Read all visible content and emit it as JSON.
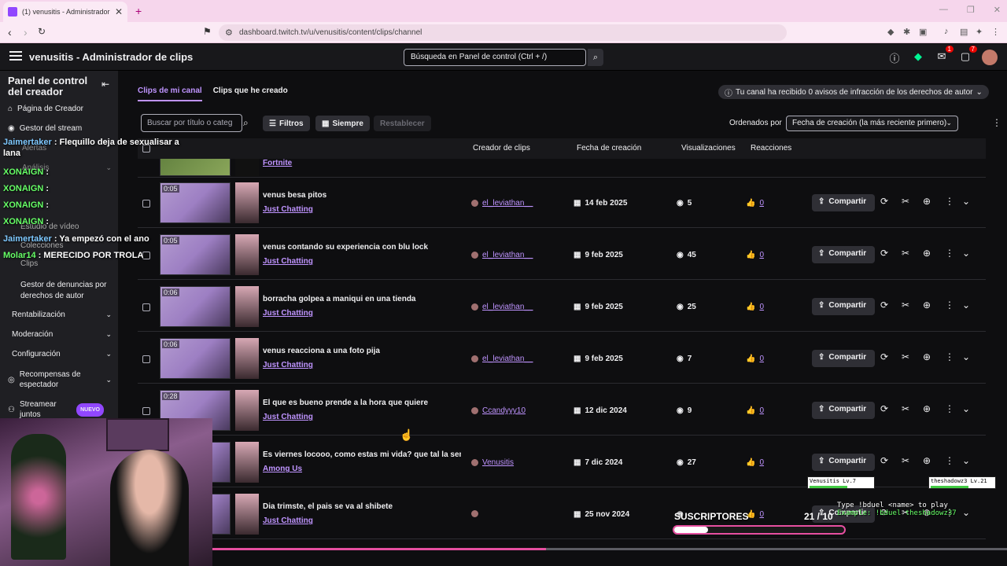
{
  "browser": {
    "tab_title": "(1) venusitis - Administrador de",
    "url": "dashboard.twitch.tv/u/venusitis/content/clips/channel"
  },
  "topnav": {
    "title": "venusitis - Administrador de clips",
    "search_placeholder": "Búsqueda en Panel de control (Ctrl + /)",
    "badges": [
      "1",
      "7"
    ]
  },
  "sidebar": {
    "header": "Panel de control del creador",
    "items": [
      {
        "label": "Página de Creador",
        "icon": "home-icon"
      },
      {
        "label": "Gestor del stream",
        "icon": "broadcast-icon"
      },
      {
        "label": "Alertas"
      },
      {
        "label": "Análisis"
      },
      {
        "label": "Estudio de vídeo"
      },
      {
        "label": "Colecciones"
      },
      {
        "label": "Clips"
      },
      {
        "label": "Gestor de denuncias por derechos de autor"
      },
      {
        "label": "Rentabilización"
      },
      {
        "label": "Moderación"
      },
      {
        "label": "Configuración"
      },
      {
        "label": "Recompensas de espectador"
      },
      {
        "label": "Streamear juntos"
      }
    ],
    "new_badge": "NUEVO"
  },
  "main": {
    "tabs": [
      "Clips de mi canal",
      "Clips que he creado"
    ],
    "copyright_notice": "Tu canal ha recibido 0 avisos de infracción de los derechos de autor",
    "filter_placeholder": "Buscar por título o categ",
    "filters_label": "Filtros",
    "time_label": "Siempre",
    "reset_label": "Restablecer",
    "sort_label": "Ordenados por",
    "sort_value": "Fecha de creación (la más reciente primero)",
    "columns": [
      "Creador de clips",
      "Fecha de creación",
      "Visualizaciones",
      "Reacciones"
    ],
    "partial_row_category": "Fortnite",
    "share_label": "Compartir",
    "rows": [
      {
        "duration": "0:05",
        "title": "venus besa pitos",
        "category": "Just Chatting",
        "creator": "el_leviathan__",
        "date": "14 feb 2025",
        "views": "5",
        "reactions": "0"
      },
      {
        "duration": "0:05",
        "title": "venus contando su experiencia con blu lock",
        "category": "Just Chatting",
        "creator": "el_leviathan__",
        "date": "9 feb 2025",
        "views": "45",
        "reactions": "0"
      },
      {
        "duration": "0:06",
        "title": "borracha golpea a maniqui en una tienda",
        "category": "Just Chatting",
        "creator": "el_leviathan__",
        "date": "9 feb 2025",
        "views": "25",
        "reactions": "0"
      },
      {
        "duration": "0:06",
        "title": "venus reacciona a una foto pija",
        "category": "Just Chatting",
        "creator": "el_leviathan__",
        "date": "9 feb 2025",
        "views": "7",
        "reactions": "0"
      },
      {
        "duration": "0:28",
        "title": "El que es bueno prende a la hora que quiere",
        "category": "Just Chatting",
        "creator": "Ccandyyy10",
        "date": "12 dic 2024",
        "views": "9",
        "reactions": "0"
      },
      {
        "duration": "",
        "title": "Es viernes locooo, como estas mi vida? que tal la sem...",
        "category": "Among Us",
        "creator": "Venusitis",
        "date": "7 dic 2024",
        "views": "27",
        "reactions": "0"
      },
      {
        "duration": "",
        "title": "Dia trimste, el pais se va al shibete",
        "category": "Just Chatting",
        "creator": "",
        "date": "25 nov 2024",
        "views": "",
        "reactions": "0"
      }
    ]
  },
  "overlay": {
    "chat": [
      {
        "user": "Jaimertaker",
        "msg": ": Flequillo deja de sexualisar a"
      },
      {
        "user": "",
        "msg": "lana"
      },
      {
        "user": "XONAIGN",
        "msg": ":"
      },
      {
        "user": "XONAIGN",
        "msg": ":"
      },
      {
        "user": "XONAIGN",
        "msg": ":"
      },
      {
        "user": "XONAIGN",
        "msg": ":"
      },
      {
        "user": "Jaimertaker",
        "msg": ": Ya empezó con el ano"
      },
      {
        "user": "Molar14",
        "msg": ": MERECIDO POR TROLA"
      }
    ],
    "subs_label": "SUSCRIPTORES",
    "subs_count": "21 / 10",
    "subs_fill": 0.2,
    "duel_line1": "Type !bduel <name> to play",
    "duel_line2": "Example: !bduel theshadowz37",
    "hp_left": "Venusitis Lv.7",
    "hp_right": "theshadowz3 Lv.21",
    "video_progress": 0.42
  },
  "colors": {
    "accent": "#bf94ff",
    "brand": "#9147ff",
    "bg": "#0e0e10"
  }
}
